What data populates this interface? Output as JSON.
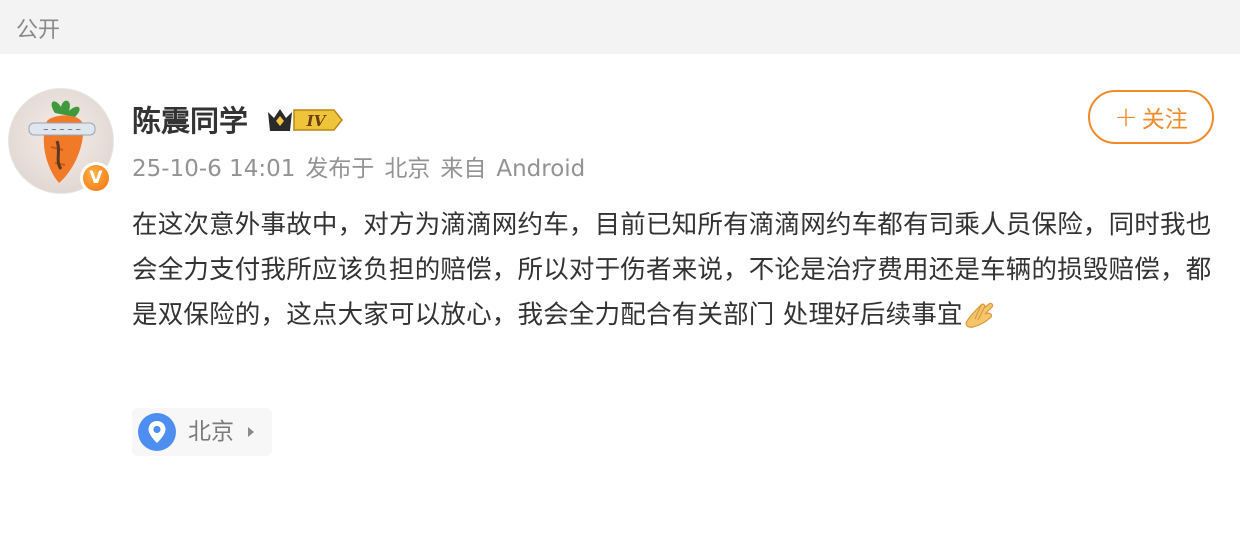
{
  "header": {
    "visibility": "公开"
  },
  "post": {
    "author": {
      "name": "陈震同学",
      "level": "IV",
      "verified_badge": "V"
    },
    "timestamp": "25-10-6 14:01",
    "posted_from_prefix": "发布于",
    "posted_location": "北京",
    "source_prefix": "来自",
    "source": "Android",
    "follow_label": "关注",
    "follow_icon": "plus-icon",
    "content": "在这次意外事故中，对方为滴滴网约车，目前已知所有滴滴网约车都有司乘人员保险，同时我也会全力支付我所应该负担的赔偿，所以对于伤者来说，不论是治疗费用还是车辆的损毁赔偿，都是双保险的，这点大家可以放心，我会全力配合有关部门 处理好后续事宜",
    "content_emoji": "folded-hands-emoji",
    "location_tag": {
      "label": "北京",
      "icon": "location-pin-icon"
    }
  },
  "colors": {
    "accent": "#f08a2b",
    "pin_blue": "#4d8ef0",
    "text_primary": "#333333",
    "text_meta": "#939393"
  }
}
